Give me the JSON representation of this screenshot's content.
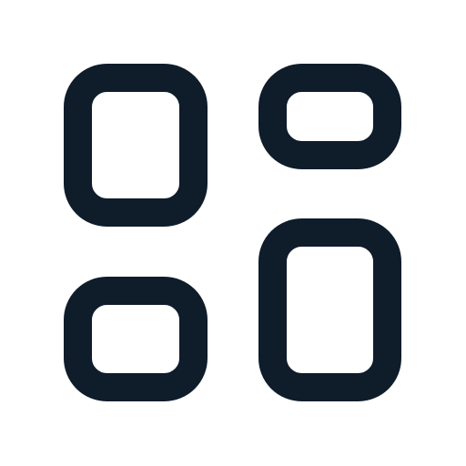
{
  "icon": {
    "name": "layout-grid-icon",
    "stroke_color": "#0F1C2A",
    "background_color": "#FFFFFF"
  }
}
